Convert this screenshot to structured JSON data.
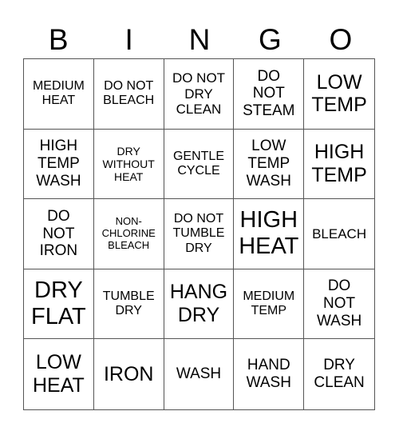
{
  "header": [
    "B",
    "I",
    "N",
    "G",
    "O"
  ],
  "cells": [
    "MEDIUM\nHEAT",
    "DO NOT\nBLEACH",
    "DO NOT\nDRY\nCLEAN",
    "DO\nNOT\nSTEAM",
    "LOW\nTEMP",
    "HIGH\nTEMP\nWASH",
    "DRY\nWITHOUT\nHEAT",
    "GENTLE\nCYCLE",
    "LOW\nTEMP\nWASH",
    "HIGH\nTEMP",
    "DO\nNOT\nIRON",
    "NON-\nCHLORINE\nBLEACH",
    "DO NOT\nTUMBLE\nDRY",
    "HIGH\nHEAT",
    "BLEACH",
    "DRY\nFLAT",
    "TUMBLE\nDRY",
    "HANG\nDRY",
    "MEDIUM\nTEMP",
    "DO\nNOT\nWASH",
    "LOW\nHEAT",
    "IRON",
    "WASH",
    "HAND\nWASH",
    "DRY\nCLEAN"
  ]
}
